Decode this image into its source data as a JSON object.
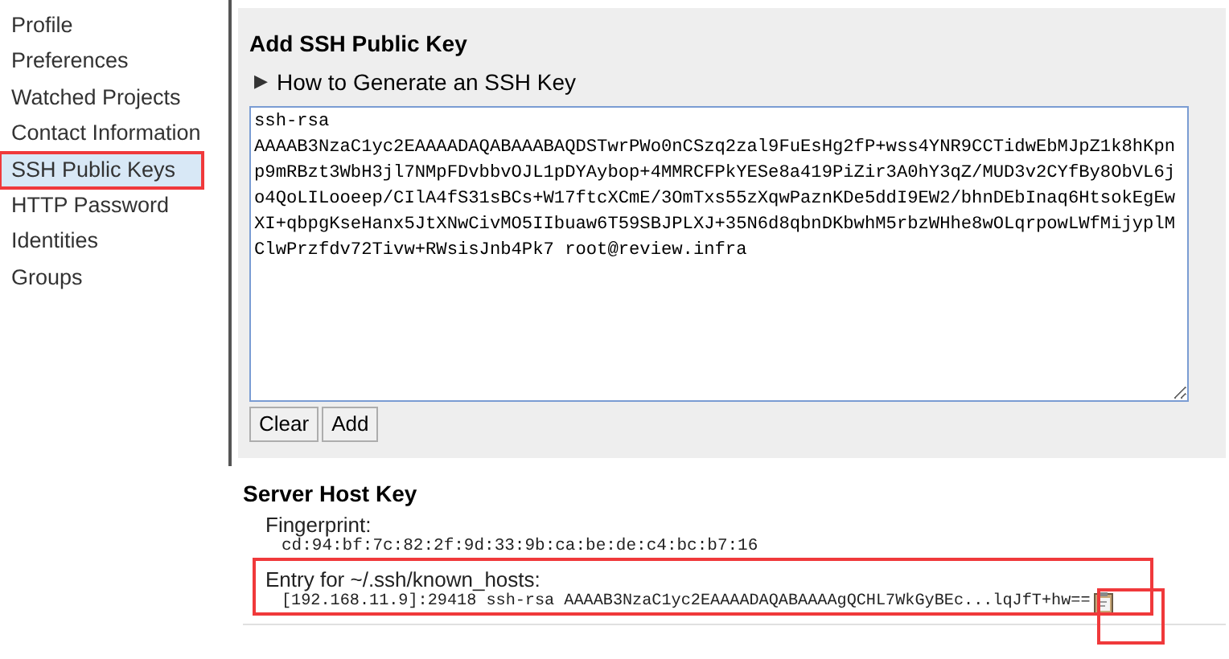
{
  "sidebar": {
    "items": [
      {
        "label": "Profile",
        "selected": false,
        "highlighted": false
      },
      {
        "label": "Preferences",
        "selected": false,
        "highlighted": false
      },
      {
        "label": "Watched Projects",
        "selected": false,
        "highlighted": false
      },
      {
        "label": "Contact Information",
        "selected": false,
        "highlighted": false
      },
      {
        "label": "SSH Public Keys",
        "selected": true,
        "highlighted": true
      },
      {
        "label": "HTTP Password",
        "selected": false,
        "highlighted": false
      },
      {
        "label": "Identities",
        "selected": false,
        "highlighted": false
      },
      {
        "label": "Groups",
        "selected": false,
        "highlighted": false
      }
    ]
  },
  "add_key": {
    "title": "Add SSH Public Key",
    "help_link": {
      "icon": "▶",
      "label": "How to Generate an SSH Key",
      "expanded": false
    },
    "key_lines": [
      "ssh-rsa",
      "AAAAB3NzaC1yc2EAAAADAQABAAABAQDSTwrPWo0nCSzq2zal9FuEsHg2fP+wss4YNR9CCTidwEbMJpZ1k8hKpn",
      "p9mRBzt3WbH3jl7NMpFDvbbvOJL1pDYAybop+4MMRCFPkYESe8a419PiZir3A0hY3qZ/MUD3v2CYfBy8ObVL6j",
      "o4QoLILooeep/CIlA4fS31sBCs+W17ftcXCmE/3OmTxs55zXqwPaznKDe5ddI9EW2/bhnDEbInaq6HtsokEgEw",
      "XI+qbpgKseHanx5JtXNwCivMO5IIbuaw6T59SBJPLXJ+35N6d8qbnDKbwhM5rbzWHhe8wOLqrpowLWfMijyplM",
      "ClwPrzfdv72Tivw+RWsisJnb4Pk7 root@review.infra"
    ],
    "buttons": [
      "Clear",
      "Add"
    ]
  },
  "server_host_key": {
    "title": "Server Host Key",
    "fingerprint_label": "Fingerprint:",
    "fingerprint": "cd:94:bf:7c:82:2f:9d:33:9b:ca:be:de:c4:bc:b7:16",
    "entry_label": "Entry for ~/.ssh/known_hosts:",
    "entry": "[192.168.11.9]:29418 ssh-rsa AAAAB3NzaC1yc2EAAAADAQABAAAAgQCHL7WkGyBEc...lqJfT+hw==",
    "entry_highlighted": true,
    "copy_highlighted": true
  }
}
